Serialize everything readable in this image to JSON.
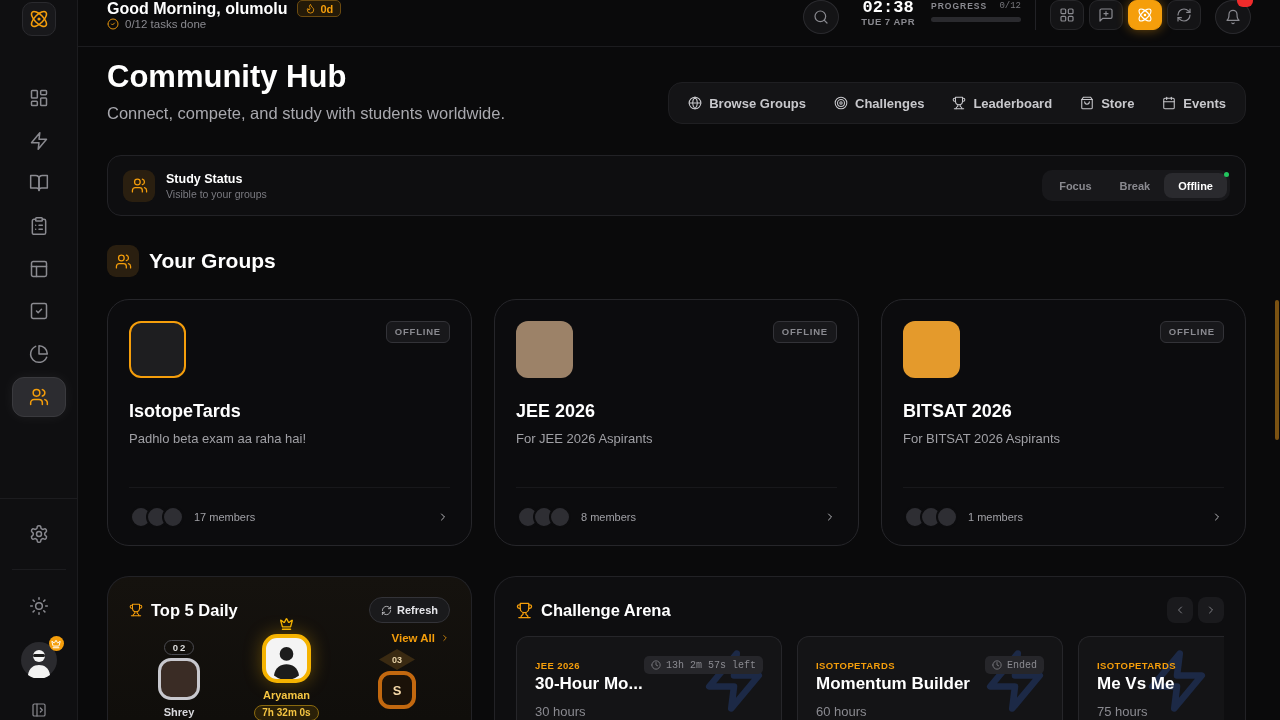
{
  "sidebar": {
    "nav": [
      {
        "selected": false
      },
      {
        "selected": false
      },
      {
        "selected": false
      },
      {
        "selected": false
      },
      {
        "selected": false
      },
      {
        "selected": false
      },
      {
        "selected": false
      },
      {
        "selected": true
      }
    ]
  },
  "header": {
    "greeting": "Good Morning, olumolu",
    "streak": "0d",
    "tasks": "0/12 tasks done",
    "time": "02:38",
    "date": "TUE 7 APR",
    "progress": {
      "label": "PROGRESS",
      "count": "0/12",
      "level": 0
    },
    "toolbar": [
      {
        "selected": false
      },
      {
        "selected": false
      },
      {
        "selected": true
      },
      {
        "selected": false
      }
    ],
    "notifications": {
      "unread": true
    }
  },
  "hub": {
    "title": "Community Hub",
    "subtitle": "Connect, compete, and study with students worldwide.",
    "nav": [
      {
        "label": "Browse Groups"
      },
      {
        "label": "Challenges"
      },
      {
        "label": "Leaderboard"
      },
      {
        "label": "Store"
      },
      {
        "label": "Events"
      }
    ]
  },
  "study_status": {
    "title": "Study Status",
    "subtitle": "Visible to your groups",
    "modes": [
      {
        "label": "Focus",
        "selected": false
      },
      {
        "label": "Break",
        "selected": false
      },
      {
        "label": "Offline",
        "selected": true
      }
    ]
  },
  "groups": {
    "title": "Your Groups",
    "items": [
      {
        "name": "IsotopeTards",
        "description": "Padhlo beta exam aa raha hai!",
        "status": "OFFLINE",
        "members": "17 members"
      },
      {
        "name": "JEE 2026",
        "description": "For JEE 2026 Aspirants",
        "status": "OFFLINE",
        "members": "8 members"
      },
      {
        "name": "BITSAT 2026",
        "description": "For BITSAT 2026 Aspirants",
        "status": "OFFLINE",
        "members": "1 members"
      }
    ]
  },
  "top_daily": {
    "title": "Top 5 Daily",
    "refresh": "Refresh",
    "view_all": "View All",
    "podium": [
      {
        "kind": "silver",
        "rank": "02",
        "name": "Shrey"
      },
      {
        "kind": "gold",
        "name": "Aryaman",
        "time": "7h 32m 0s"
      },
      {
        "kind": "bronze",
        "rank": "03",
        "initial": "S"
      }
    ]
  },
  "challenge_arena": {
    "title": "Challenge Arena",
    "challenges": [
      {
        "group": "JEE 2026",
        "timer": "13h 2m 57s left",
        "title": "30-Hour Mo...",
        "target": "30 hours"
      },
      {
        "group": "ISOTOPETARDS",
        "timer": "Ended",
        "title": "Momentum Builder",
        "target": "60 hours"
      },
      {
        "group": "ISOTOPETARDS",
        "title": "Me Vs Me",
        "target": "75 hours"
      }
    ]
  }
}
